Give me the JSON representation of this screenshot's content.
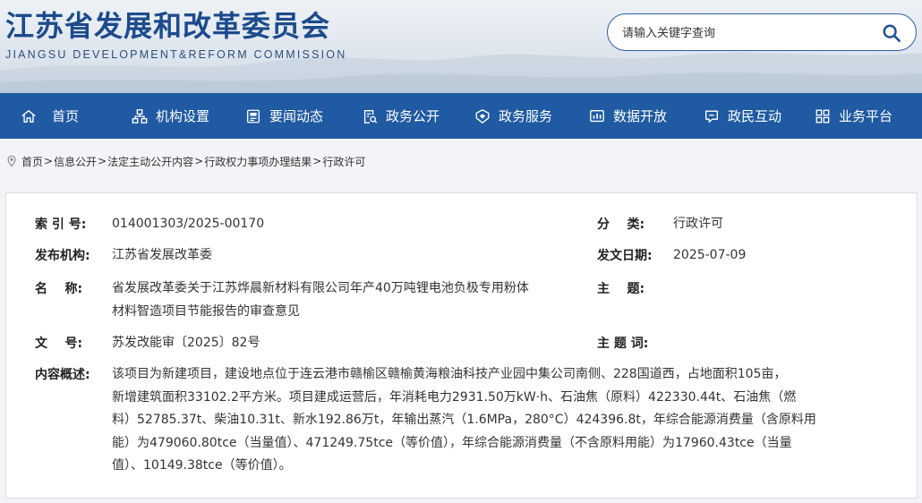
{
  "site": {
    "title": "江苏省发展和改革委员会",
    "subtitle": "JIANGSU DEVELOPMENT&REFORM COMMISSION"
  },
  "search": {
    "placeholder": "请输入关键字查询",
    "icon": "search-icon"
  },
  "nav": {
    "items": [
      {
        "label": "首页",
        "icon": "home-icon"
      },
      {
        "label": "机构设置",
        "icon": "org-chart-icon"
      },
      {
        "label": "要闻动态",
        "icon": "news-icon"
      },
      {
        "label": "政务公开",
        "icon": "document-search-icon"
      },
      {
        "label": "政务服务",
        "icon": "service-icon"
      },
      {
        "label": "数据开放",
        "icon": "data-chart-icon"
      },
      {
        "label": "政民互动",
        "icon": "chat-icon"
      },
      {
        "label": "业务平台",
        "icon": "grid-icon"
      }
    ],
    "bg_color": "#1f5aa2"
  },
  "breadcrumb": {
    "items": [
      "首页",
      "信息公开",
      "法定主动公开内容",
      "行政权力事项办理结果",
      "行政许可"
    ],
    "separator": ">"
  },
  "meta": {
    "index_label": "索 引 号:",
    "index_value": "014001303/2025-00170",
    "category_label": "分    类:",
    "category_value": "行政许可",
    "publisher_label": "发布机构:",
    "publisher_value": "江苏省发展改革委",
    "date_label": "发文日期:",
    "date_value": "2025-07-09",
    "name_label": "名    称:",
    "name_value_line1": "省发展改革委关于江苏烨晨新材料有限公司年产40万吨锂电池负极专用粉体",
    "name_value_line2": "材料智造项目节能报告的审查意见",
    "topic_label": "主    题:",
    "doc_no_label": "文    号:",
    "doc_no_value": "苏发改能审〔2025〕82号",
    "keywords_label": "主 题 词:",
    "summary_label": "内容概述:",
    "summary_lines": [
      "该项目为新建项目，建设地点位于连云港市赣榆区赣榆黄海粮油科技产业园中集公司南侧、228国道西，占地面积105亩，",
      "新增建筑面积33102.2平方米。项目建成运营后，年消耗电力2931.50万kW·h、石油焦（原料）422330.44t、石油焦（燃",
      "料）52785.37t、柴油10.31t、新水192.86万t，年输出蒸汽（1.6MPa，280°C）424396.8t，年综合能源消费量（含原料用",
      "能）为479060.80tce（当量值）、471249.75tce（等价值），年综合能源消费量（不含原料用能）为17960.43tce（当量",
      "值）、10149.38tce（等价值）。"
    ]
  }
}
